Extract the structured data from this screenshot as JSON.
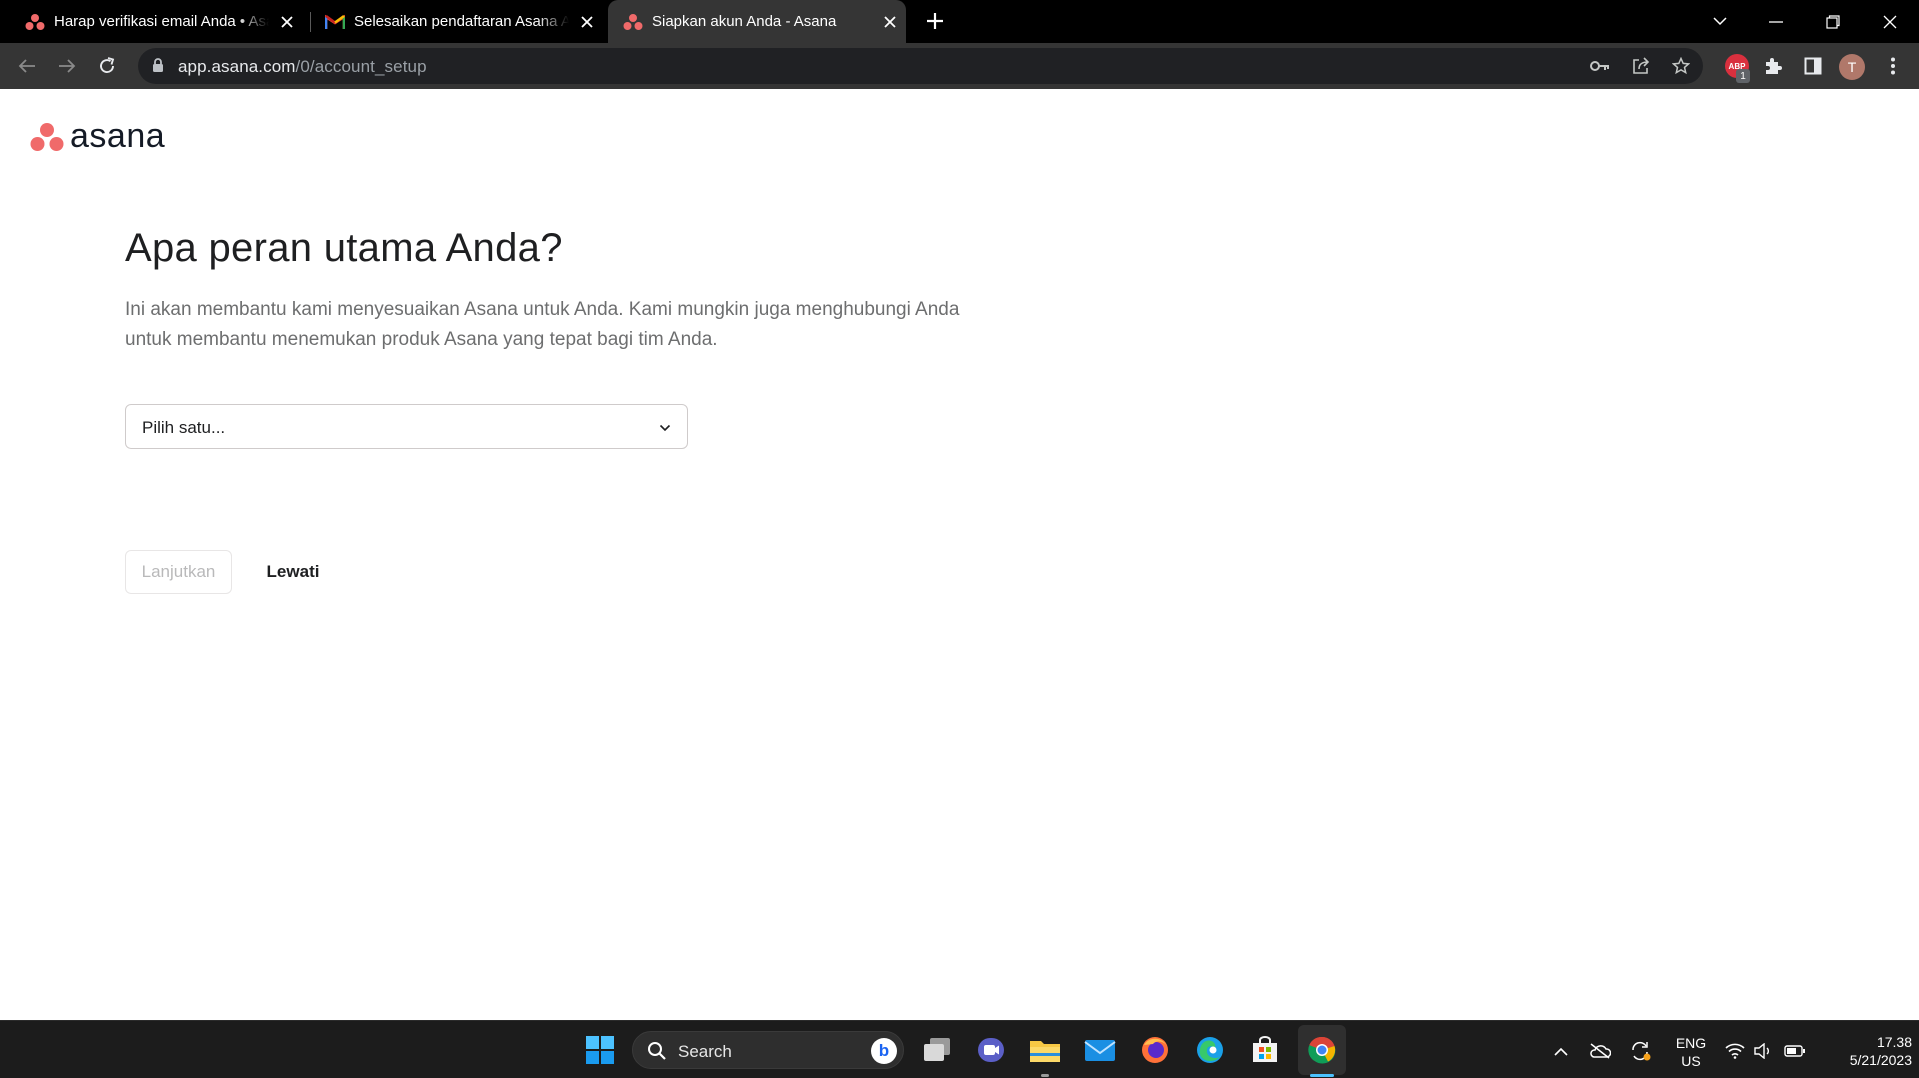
{
  "browser": {
    "tabs": [
      {
        "title": "Harap verifikasi email Anda • Asana",
        "favicon": "asana-icon",
        "active": false
      },
      {
        "title": "Selesaikan pendaftaran Asana Anda",
        "favicon": "gmail-icon",
        "active": false
      },
      {
        "title": "Siapkan akun Anda - Asana",
        "favicon": "asana-icon",
        "active": true
      }
    ],
    "url_host": "app.asana.com",
    "url_path": "/0/account_setup",
    "extension_badge": "ABP",
    "extension_count": "1",
    "profile_initial": "T"
  },
  "page": {
    "logo_text": "asana",
    "heading": "Apa peran utama Anda?",
    "description": "Ini akan membantu kami menyesuaikan Asana untuk Anda. Kami mungkin juga menghubungi Anda untuk membantu menemukan produk Asana yang tepat bagi tim Anda.",
    "role_select": {
      "placeholder": "Pilih satu..."
    },
    "continue_label": "Lanjutkan",
    "skip_label": "Lewati"
  },
  "taskbar": {
    "search_label": "Search",
    "language": "ENG",
    "region": "US",
    "time": "17.38",
    "date": "5/21/2023"
  },
  "colors": {
    "asana_coral": "#f06a6a",
    "browser_frame": "#000000",
    "toolbar": "#353535",
    "taskbar": "#1c1c1c"
  }
}
